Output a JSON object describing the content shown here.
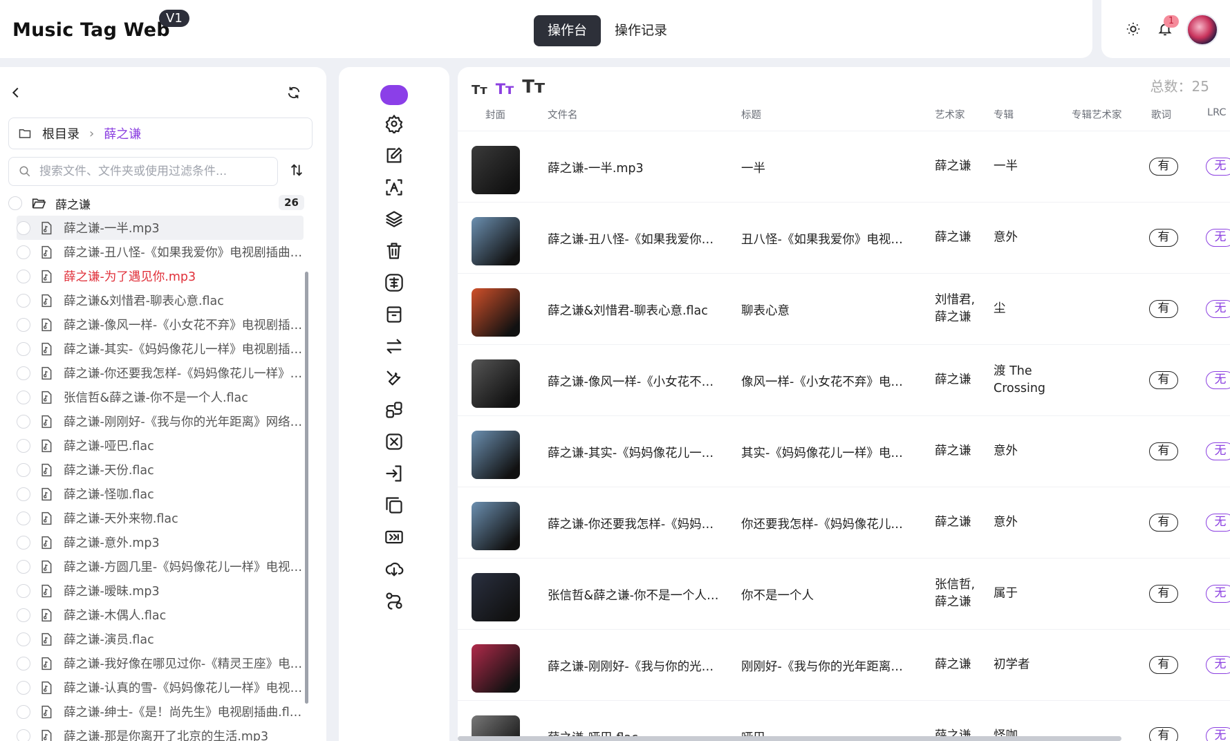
{
  "app": {
    "title": "Music Tag Web",
    "version": "V1"
  },
  "header": {
    "tabs": [
      {
        "label": "操作台",
        "active": true
      },
      {
        "label": "操作记录",
        "active": false
      }
    ],
    "notification_count": "1"
  },
  "sidebar": {
    "breadcrumb": {
      "root": "根目录",
      "current": "薛之谦"
    },
    "search_placeholder": "搜索文件、文件夹或使用过滤条件...",
    "folder": {
      "name": "薛之谦",
      "count": "26"
    },
    "files": [
      {
        "name": "薛之谦-一半.mp3",
        "highlight": true
      },
      {
        "name": "薛之谦-丑八怪-《如果我爱你》电视剧插曲.flac"
      },
      {
        "name": "薛之谦-为了遇见你.mp3",
        "red": true
      },
      {
        "name": "薛之谦&刘惜君-聊表心意.flac"
      },
      {
        "name": "薛之谦-像风一样-《小女花不弃》电视剧插曲.flac"
      },
      {
        "name": "薛之谦-其实-《妈妈像花儿一样》电视剧插曲.flac"
      },
      {
        "name": "薛之谦-你还要我怎样-《妈妈像花儿一样》电视剧插曲.flac"
      },
      {
        "name": "张信哲&薛之谦-你不是一个人.flac"
      },
      {
        "name": "薛之谦-刚刚好-《我与你的光年距离》网络剧插曲.flac"
      },
      {
        "name": "薛之谦-哑巴.flac"
      },
      {
        "name": "薛之谦-天份.flac"
      },
      {
        "name": "薛之谦-怪咖.flac"
      },
      {
        "name": "薛之谦-天外来物.flac"
      },
      {
        "name": "薛之谦-意外.mp3"
      },
      {
        "name": "薛之谦-方圆几里-《妈妈像花儿一样》电视剧插曲.flac"
      },
      {
        "name": "薛之谦-暧昧.mp3"
      },
      {
        "name": "薛之谦-木偶人.flac"
      },
      {
        "name": "薛之谦-演员.flac"
      },
      {
        "name": "薛之谦-我好像在哪见过你-《精灵王座》电影主题曲.flac"
      },
      {
        "name": "薛之谦-认真的雪-《妈妈像花儿一样》电视剧插曲.flac"
      },
      {
        "name": "薛之谦-绅士-《是！尚先生》电视剧插曲.flac"
      },
      {
        "name": "薛之谦-那是你离开了北京的生活.mp3"
      }
    ]
  },
  "toolbar": {
    "icons": [
      "settings-icon",
      "edit-icon",
      "text-recognition-icon",
      "layers-icon",
      "trash-icon",
      "traditional-chinese-icon",
      "archive-icon",
      "swap-icon",
      "tools-icon",
      "group-icon",
      "replace-icon",
      "import-icon",
      "copy-icon",
      "fast-forward-icon",
      "cloud-download-icon",
      "flow-icon"
    ]
  },
  "main": {
    "font_sizes": [
      "Tт",
      "Tт",
      "Tт"
    ],
    "total": "总数：25",
    "columns": [
      "封面",
      "文件名",
      "标题",
      "艺术家",
      "专辑",
      "专辑艺术家",
      "歌词",
      "LRC"
    ],
    "rows": [
      {
        "file": "薛之谦-一半.mp3",
        "title": "一半",
        "artist": "薛之谦",
        "album": "一半",
        "lyrics": "有",
        "lrc": "无",
        "cover": "#3a3a3a"
      },
      {
        "file": "薛之谦-丑八怪-《如果我爱你》电视剧插曲.flac",
        "title": "丑八怪-《如果我爱你》电视剧插曲",
        "artist": "薛之谦",
        "album": "意外",
        "lyrics": "有",
        "lrc": "无",
        "cover": "#6b8fb0"
      },
      {
        "file": "薛之谦&刘惜君-聊表心意.flac",
        "title": "聊表心意",
        "artist": "刘惜君, 薛之谦",
        "album": "尘",
        "lyrics": "有",
        "lrc": "无",
        "cover": "#d0502a"
      },
      {
        "file": "薛之谦-像风一样-《小女花不弃》电视剧插曲.flac",
        "title": "像风一样-《小女花不弃》电视剧插曲",
        "artist": "薛之谦",
        "album": "渡 The Crossing",
        "lyrics": "有",
        "lrc": "无",
        "cover": "#555555"
      },
      {
        "file": "薛之谦-其实-《妈妈像花儿一样》电视剧插曲.flac",
        "title": "其实-《妈妈像花儿一样》电视剧插曲",
        "artist": "薛之谦",
        "album": "意外",
        "lyrics": "有",
        "lrc": "无",
        "cover": "#6b8fb0"
      },
      {
        "file": "薛之谦-你还要我怎样-《妈妈像花儿一样》电视剧插曲.flac",
        "title": "你还要我怎样-《妈妈像花儿一样》电视剧插曲",
        "artist": "薛之谦",
        "album": "意外",
        "lyrics": "有",
        "lrc": "无",
        "cover": "#6b8fb0"
      },
      {
        "file": "张信哲&薛之谦-你不是一个人.flac",
        "title": "你不是一个人",
        "artist": "张信哲, 薛之谦",
        "album": "属于",
        "lyrics": "有",
        "lrc": "无",
        "cover": "#2a3040"
      },
      {
        "file": "薛之谦-刚刚好-《我与你的光年距离》网络剧插曲.flac",
        "title": "刚刚好-《我与你的光年距离》网络剧插曲",
        "artist": "薛之谦",
        "album": "初学者",
        "lyrics": "有",
        "lrc": "无",
        "cover": "#b02a4a"
      },
      {
        "file": "薛之谦-哑巴.flac",
        "title": "哑巴",
        "artist": "薛之谦",
        "album": "怪咖",
        "lyrics": "有",
        "lrc": "无",
        "cover": "#777777"
      }
    ]
  },
  "colors": {
    "accent": "#8b3fe8",
    "dark": "#2d3039",
    "red": "#e0303a"
  }
}
